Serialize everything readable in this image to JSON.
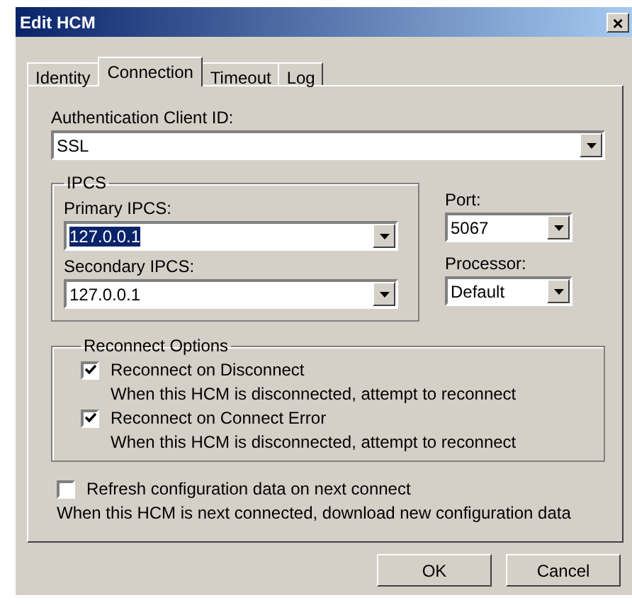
{
  "window": {
    "title": "Edit HCM",
    "close": "×"
  },
  "tabs": [
    {
      "label": "Identity",
      "selected": false
    },
    {
      "label": "Connection",
      "selected": true
    },
    {
      "label": "Timeout",
      "selected": false
    },
    {
      "label": "Log",
      "selected": false
    }
  ],
  "auth_client_id": {
    "label": "Authentication Client ID:",
    "value": "SSL"
  },
  "ipcs": {
    "title": "IPCS",
    "fields": [
      {
        "label": "Primary IPCS:",
        "value": "127.0.0.1",
        "highlighted": true
      },
      {
        "label": "Secondary IPCS:",
        "value": "127.0.0.1",
        "highlighted": false
      }
    ]
  },
  "side_fields": [
    {
      "label": "Port:",
      "value": "5067"
    },
    {
      "label": "Processor:",
      "value": "Default"
    }
  ],
  "reconnect_options": {
    "title": "Reconnect Options",
    "items": [
      {
        "label": "Reconnect on Disconnect",
        "checked": true,
        "description": "When this HCM is disconnected, attempt to reconnect"
      },
      {
        "label": "Reconnect on Connect Error",
        "checked": true,
        "description": "When this HCM is disconnected, attempt to reconnect"
      }
    ]
  },
  "refresh": {
    "label": "Refresh configuration data on next connect",
    "checked": false,
    "description": "When this HCM is next connected, download new configuration data"
  },
  "buttons": [
    "OK",
    "Cancel"
  ]
}
